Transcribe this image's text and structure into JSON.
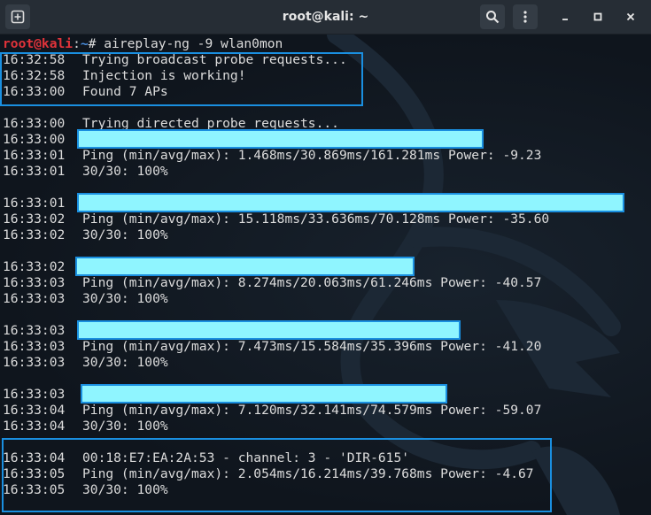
{
  "titlebar": {
    "title": "root@kali: ~",
    "new_tab_icon": "new-tab-icon",
    "search_icon": "search-icon",
    "menu_icon": "hamburger-menu-icon"
  },
  "prompt": {
    "user": "root@kali",
    "path": "~",
    "symbol": "# ",
    "command": "aireplay-ng -9 wlan0mon"
  },
  "output": [
    {
      "time": "16:32:58",
      "text": "Trying broadcast probe requests..."
    },
    {
      "time": "16:32:58",
      "text": "Injection is working!"
    },
    {
      "time": "16:33:00",
      "text": "Found 7 APs"
    },
    {
      "time": "",
      "text": ""
    },
    {
      "time": "16:33:00",
      "text": "Trying directed probe requests..."
    },
    {
      "time": "16:33:00",
      "text": ""
    },
    {
      "time": "16:33:01",
      "text": "Ping (min/avg/max): 1.468ms/30.869ms/161.281ms Power: -9.23"
    },
    {
      "time": "16:33:01",
      "text": "30/30: 100%"
    },
    {
      "time": "",
      "text": ""
    },
    {
      "time": "16:33:01",
      "text": ""
    },
    {
      "time": "16:33:02",
      "text": "Ping (min/avg/max): 15.118ms/33.636ms/70.128ms Power: -35.60"
    },
    {
      "time": "16:33:02",
      "text": "30/30: 100%"
    },
    {
      "time": "",
      "text": ""
    },
    {
      "time": "16:33:02",
      "text": ""
    },
    {
      "time": "16:33:03",
      "text": "Ping (min/avg/max): 8.274ms/20.063ms/61.246ms Power: -40.57"
    },
    {
      "time": "16:33:03",
      "text": "30/30: 100%"
    },
    {
      "time": "",
      "text": ""
    },
    {
      "time": "16:33:03",
      "text": ""
    },
    {
      "time": "16:33:03",
      "text": "Ping (min/avg/max): 7.473ms/15.584ms/35.396ms Power: -41.20"
    },
    {
      "time": "16:33:03",
      "text": "30/30: 100%"
    },
    {
      "time": "",
      "text": ""
    },
    {
      "time": "16:33:03",
      "text": ""
    },
    {
      "time": "16:33:04",
      "text": "Ping (min/avg/max): 7.120ms/32.141ms/74.579ms Power: -59.07"
    },
    {
      "time": "16:33:04",
      "text": "30/30: 100%"
    },
    {
      "time": "",
      "text": ""
    },
    {
      "time": "16:33:04",
      "text": "00:18:E7:EA:2A:53 - channel: 3 - 'DIR-615'"
    },
    {
      "time": "16:33:05",
      "text": "Ping (min/avg/max): 2.054ms/16.214ms/39.768ms Power: -4.67"
    },
    {
      "time": "16:33:05",
      "text": "30/30: 100%"
    }
  ],
  "colors": {
    "highlight_border": "#1a8fe0",
    "redaction_fill": "#8ff5ff",
    "prompt_user": "#e0333a",
    "prompt_path": "#4a90e2"
  }
}
